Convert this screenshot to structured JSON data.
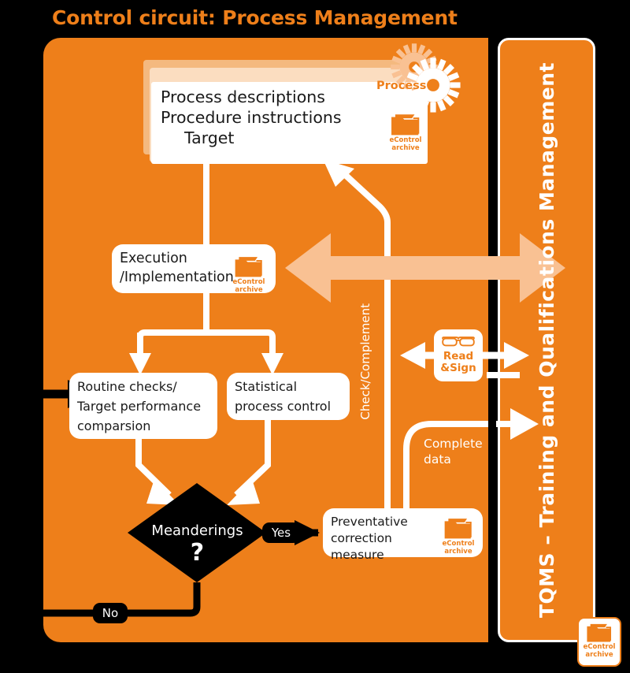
{
  "title": "Control circuit: Process Management",
  "colors": {
    "orange": "#ee7f1a",
    "light_orange": "#f9c193",
    "pale_orange": "#fbddc0",
    "white": "#ffffff",
    "black": "#000000"
  },
  "right_panel": {
    "label": "TQMS – Training and Qualifications Management"
  },
  "document_stack": {
    "lines": [
      "Process descriptions",
      "Procedure instructions",
      "Target"
    ],
    "badge": "Process",
    "icon": "gears-icon",
    "archive": {
      "line1": "eControl",
      "line2": "archive"
    }
  },
  "nodes": {
    "execution": {
      "lines": [
        "Execution",
        "/Implementation"
      ],
      "archive": {
        "line1": "eControl",
        "line2": "archive"
      }
    },
    "routine_checks": {
      "lines": [
        "Routine checks/",
        "Target performance",
        "comparsion"
      ]
    },
    "statistical": {
      "lines": [
        "Statistical",
        "process control"
      ]
    },
    "decision": {
      "label": "Meanderings",
      "mark": "?"
    },
    "preventative": {
      "lines": [
        "Preventative",
        "correction measure"
      ],
      "archive": {
        "line1": "eControl",
        "line2": "archive"
      }
    }
  },
  "edge_labels": {
    "yes": "Yes",
    "no": "No",
    "check_complement": "Check/Complement",
    "complete_data": [
      "Complete",
      "data"
    ]
  },
  "read_sign": {
    "line1": "Read",
    "line2": "&Sign",
    "icon": "glasses-icon"
  },
  "corner_archive": {
    "line1": "eControl",
    "line2": "archive"
  }
}
